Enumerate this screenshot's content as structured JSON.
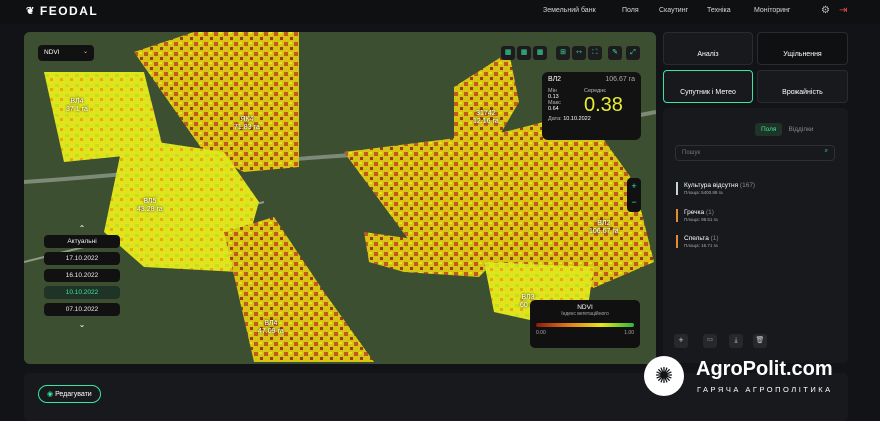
{
  "app": {
    "logo": "FEODAL"
  },
  "nav": [
    "Земельний банк",
    "Поля",
    "Скаутинг",
    "Техніка",
    "Моніторинг"
  ],
  "map": {
    "layer": "NDVI",
    "fields": [
      {
        "name": "ВЛ4",
        "area": "37.1 га"
      },
      {
        "name": "ЯК4",
        "area": "71.83 га"
      },
      {
        "name": "ВЛ5",
        "area": "43.28 га"
      },
      {
        "name": "31742",
        "area": "12.16 га"
      },
      {
        "name": "ВЛ2",
        "area": "106.67 га"
      },
      {
        "name": "ВЛ4",
        "area": "47.09 га"
      },
      {
        "name": "ВЛ3",
        "area": "60 га"
      }
    ],
    "popup": {
      "title": "ВЛ2",
      "area": "106.67 га",
      "min_label": "Мін",
      "min": "0.13",
      "avg_label": "Середнє",
      "max_label": "Макс",
      "max": "0.64",
      "value": "0.38",
      "date_label": "Дата:",
      "date": "10.10.2022"
    },
    "dates": [
      "Актуальні",
      "17.10.2022",
      "16.10.2022",
      "10.10.2022",
      "07.10.2022"
    ],
    "legend": {
      "title": "NDVI",
      "subtitle": "Індекс вегетаційного",
      "min": "0.00",
      "max": "1.00"
    }
  },
  "panel": {
    "tabs": [
      "Аналіз",
      "Ущільнення",
      "Супутник і Метео",
      "Врожайність"
    ],
    "subtabs": [
      "Поля",
      "Відділки"
    ],
    "search_placeholder": "Пошук",
    "crops": [
      {
        "name": "Культура відсутня",
        "count": "(167)",
        "area": "Площа: 5400.88 га",
        "color": "#c9d3d6"
      },
      {
        "name": "Гречка",
        "count": "(1)",
        "area": "Площа: 98.51 га",
        "color": "#e88a32"
      },
      {
        "name": "Спельта",
        "count": "(1)",
        "area": "Площа: 16.71 га",
        "color": "#e88a32"
      }
    ]
  },
  "bottom": {
    "edit": "Редагувати"
  },
  "watermark": {
    "brand": "AgroPolit.com",
    "tagline": "ГАРЯЧА АГРОПОЛІТИКА"
  }
}
